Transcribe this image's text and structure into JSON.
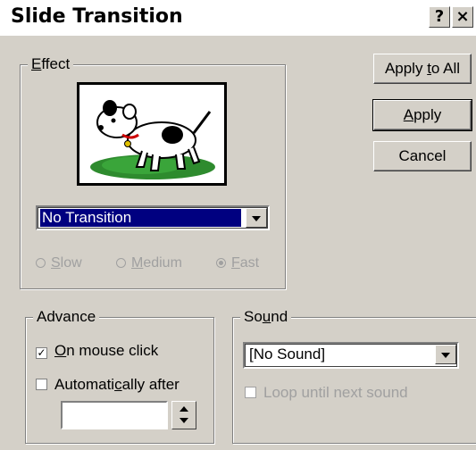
{
  "window": {
    "title": "Slide Transition",
    "help_icon": "?",
    "close_icon": "×"
  },
  "effect": {
    "group_label_u": "E",
    "group_label_rest": "ffect",
    "preview_icon": "dog-picture",
    "transition_value": "No Transition",
    "speed_options": [
      {
        "u": "S",
        "rest": "low"
      },
      {
        "pre": "",
        "u": "M",
        "rest": "edium"
      },
      {
        "u": "F",
        "rest": "ast"
      }
    ]
  },
  "buttons": {
    "apply_all_pre": "Apply ",
    "apply_all_u": "t",
    "apply_all_rest": "o All",
    "apply_u": "A",
    "apply_rest": "pply",
    "cancel": "Cancel"
  },
  "advance": {
    "group_label": "Advance",
    "on_click_u": "O",
    "on_click_rest": "n mouse click",
    "on_click_checked": "✓",
    "auto_pre": "Automati",
    "auto_u": "c",
    "auto_rest": "ally after",
    "auto_value": ""
  },
  "sound": {
    "group_label_pre": "So",
    "group_label_u": "u",
    "group_label_rest": "nd",
    "value": "[No Sound]",
    "loop_label": "Loop until next sound"
  },
  "colors": {
    "face": "#d4d0c8",
    "selection": "#000080"
  }
}
